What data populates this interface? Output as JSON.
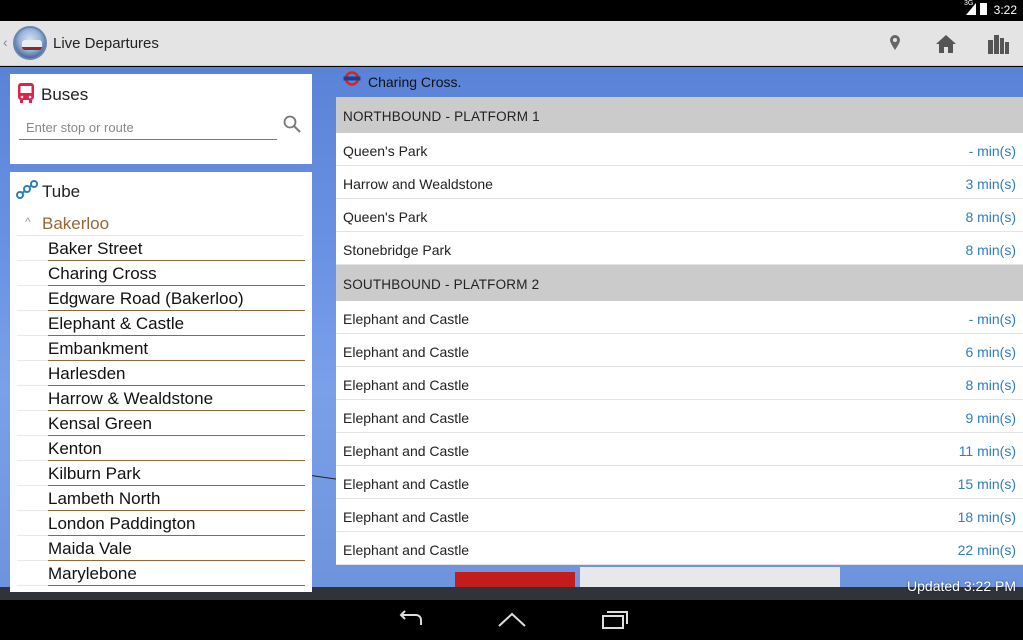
{
  "status_bar": {
    "network": "3G",
    "time": "3:22"
  },
  "action_bar": {
    "title": "Live Departures",
    "actions": [
      "location-icon",
      "home-icon",
      "city-icon"
    ]
  },
  "buses": {
    "label": "Buses",
    "search_placeholder": "Enter stop or route"
  },
  "tube": {
    "label": "Tube",
    "line_name": "Bakerloo",
    "line_color": "#996633",
    "stations": [
      "Baker Street",
      "Charing Cross",
      "Edgware Road (Bakerloo)",
      "Elephant & Castle",
      "Embankment",
      "Harlesden",
      "Harrow & Wealdstone",
      "Kensal Green",
      "Kenton",
      "Kilburn Park",
      "Lambeth North",
      "London Paddington",
      "Maida Vale",
      "Marylebone"
    ]
  },
  "departures": {
    "station": "Charing Cross.",
    "accent_color": "#2e7dc1",
    "platforms": [
      {
        "name": "NORTHBOUND - PLATFORM 1",
        "rows": [
          {
            "dest": "Queen's Park",
            "mins": "- min(s)"
          },
          {
            "dest": "Harrow and Wealdstone",
            "mins": "3 min(s)"
          },
          {
            "dest": "Queen's Park",
            "mins": "8 min(s)"
          },
          {
            "dest": "Stonebridge Park",
            "mins": "8 min(s)"
          }
        ]
      },
      {
        "name": "SOUTHBOUND - PLATFORM 2",
        "rows": [
          {
            "dest": "Elephant and Castle",
            "mins": "- min(s)"
          },
          {
            "dest": "Elephant and Castle",
            "mins": "6 min(s)"
          },
          {
            "dest": "Elephant and Castle",
            "mins": "8 min(s)"
          },
          {
            "dest": "Elephant and Castle",
            "mins": "9 min(s)"
          },
          {
            "dest": "Elephant and Castle",
            "mins": "11 min(s)"
          },
          {
            "dest": "Elephant and Castle",
            "mins": "15 min(s)"
          },
          {
            "dest": "Elephant and Castle",
            "mins": "18 min(s)"
          },
          {
            "dest": "Elephant and Castle",
            "mins": "22 min(s)"
          }
        ]
      }
    ],
    "updated": "Updated 3:22 PM"
  },
  "nav_bar": {
    "buttons": [
      "back-icon",
      "home-icon",
      "recent-apps-icon"
    ]
  }
}
